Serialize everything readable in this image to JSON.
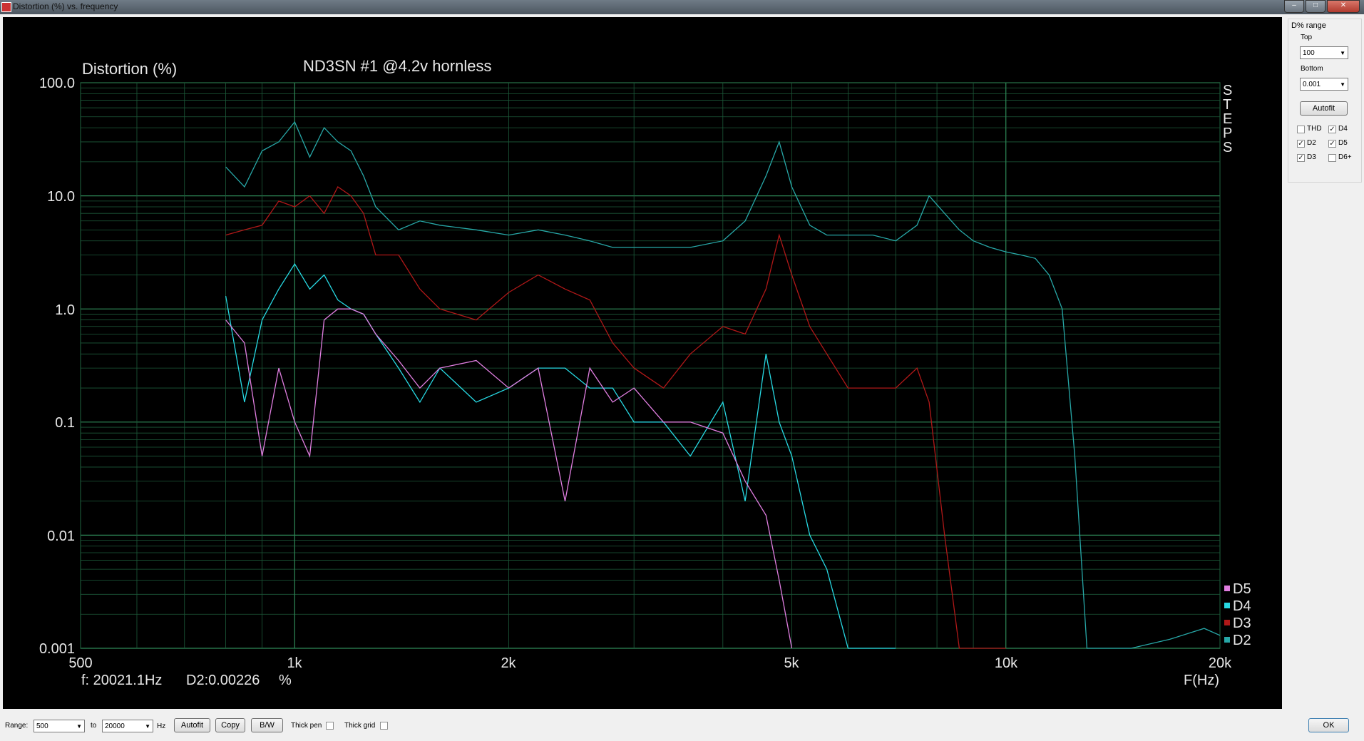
{
  "window": {
    "title": "Distortion (%) vs. frequency"
  },
  "plot": {
    "ylabel": "Distortion (%)",
    "title": "ND3SN #1 @4.2v hornless",
    "side_text": [
      "S",
      "T",
      "E",
      "P",
      "S"
    ],
    "xlabel": "F(Hz)",
    "yticks": [
      "100.0",
      "10.0",
      "1.0",
      "0.1",
      "0.01",
      "0.001"
    ],
    "xticks": [
      "500",
      "1k",
      "2k",
      "5k",
      "10k",
      "20k"
    ],
    "readout_f": "f: 20021.1Hz",
    "readout_d": "D2:0.00226",
    "readout_unit": "%",
    "legend": [
      {
        "name": "D5",
        "color": "#e07ee0"
      },
      {
        "name": "D4",
        "color": "#27d9e3"
      },
      {
        "name": "D3",
        "color": "#b01818"
      },
      {
        "name": "D2",
        "color": "#27a7a7"
      }
    ]
  },
  "side_panel": {
    "group_label": "D% range",
    "top_label": "Top",
    "top_value": "100",
    "bottom_label": "Bottom",
    "bottom_value": "0.001",
    "autofit": "Autofit",
    "checks": [
      {
        "label": "THD",
        "checked": false
      },
      {
        "label": "D4",
        "checked": true
      },
      {
        "label": "D2",
        "checked": true
      },
      {
        "label": "D5",
        "checked": true
      },
      {
        "label": "D3",
        "checked": true
      },
      {
        "label": "D6+",
        "checked": false
      }
    ]
  },
  "bottom_bar": {
    "range_label": "Range:",
    "range_from": "500",
    "to_label": "to",
    "range_to": "20000",
    "hz_label": "Hz",
    "autofit": "Autofit",
    "copy": "Copy",
    "bw": "B/W",
    "thick_pen": "Thick pen",
    "thick_grid": "Thick grid",
    "ok": "OK"
  },
  "chart_data": {
    "type": "line",
    "title": "ND3SN #1 @4.2v hornless",
    "xlabel": "F(Hz)",
    "ylabel": "Distortion (%)",
    "x_scale": "log",
    "y_scale": "log",
    "xlim": [
      500,
      20000
    ],
    "ylim": [
      0.001,
      100
    ],
    "grid": true,
    "legend_position": "bottom-right",
    "series": [
      {
        "name": "D2",
        "color": "#27a7a7",
        "x": [
          800,
          850,
          900,
          950,
          1000,
          1050,
          1100,
          1150,
          1200,
          1250,
          1300,
          1400,
          1500,
          1600,
          1800,
          2000,
          2200,
          2400,
          2600,
          2800,
          3000,
          3300,
          3600,
          4000,
          4300,
          4600,
          4800,
          5000,
          5300,
          5600,
          6000,
          6500,
          7000,
          7500,
          7800,
          8200,
          8600,
          9000,
          9500,
          10000,
          10500,
          11000,
          11500,
          12000,
          12500,
          13000,
          15000,
          17000,
          19000,
          20000
        ],
        "y": [
          18,
          12,
          25,
          30,
          45,
          22,
          40,
          30,
          25,
          15,
          8,
          5,
          6,
          5.5,
          5,
          4.5,
          5,
          4.5,
          4,
          3.5,
          3.5,
          3.5,
          3.5,
          4,
          6,
          15,
          30,
          12,
          5.5,
          4.5,
          4.5,
          4.5,
          4,
          5.5,
          10,
          7,
          5,
          4,
          3.5,
          3.2,
          3.0,
          2.8,
          2,
          1,
          0.05,
          0.001,
          0.001,
          0.0012,
          0.0015,
          0.0013
        ]
      },
      {
        "name": "D3",
        "color": "#b01818",
        "x": [
          800,
          850,
          900,
          950,
          1000,
          1050,
          1100,
          1150,
          1200,
          1250,
          1300,
          1400,
          1500,
          1600,
          1800,
          2000,
          2200,
          2400,
          2600,
          2800,
          3000,
          3300,
          3600,
          4000,
          4300,
          4600,
          4800,
          5000,
          5300,
          5600,
          6000,
          6500,
          7000,
          7500,
          7800,
          8200,
          8600,
          9000,
          9500,
          10000
        ],
        "y": [
          4.5,
          5,
          5.5,
          9,
          8,
          10,
          7,
          12,
          10,
          7,
          3,
          3,
          1.5,
          1,
          0.8,
          1.4,
          2,
          1.5,
          1.2,
          0.5,
          0.3,
          0.2,
          0.4,
          0.7,
          0.6,
          1.5,
          4.5,
          2,
          0.7,
          0.4,
          0.2,
          0.2,
          0.2,
          0.3,
          0.15,
          0.01,
          0.001,
          0.001,
          0.001,
          0.001
        ]
      },
      {
        "name": "D4",
        "color": "#27d9e3",
        "x": [
          800,
          850,
          900,
          950,
          1000,
          1050,
          1100,
          1150,
          1200,
          1250,
          1300,
          1400,
          1500,
          1600,
          1800,
          2000,
          2200,
          2400,
          2600,
          2800,
          3000,
          3300,
          3600,
          4000,
          4300,
          4600,
          4800,
          5000,
          5300,
          5600,
          6000,
          6500,
          7000
        ],
        "y": [
          1.3,
          0.15,
          0.8,
          1.5,
          2.5,
          1.5,
          2,
          1.2,
          1,
          0.9,
          0.6,
          0.3,
          0.15,
          0.3,
          0.15,
          0.2,
          0.3,
          0.3,
          0.2,
          0.2,
          0.1,
          0.1,
          0.05,
          0.15,
          0.02,
          0.4,
          0.1,
          0.05,
          0.01,
          0.005,
          0.001,
          0.001,
          0.001
        ]
      },
      {
        "name": "D5",
        "color": "#e07ee0",
        "x": [
          800,
          850,
          900,
          950,
          1000,
          1050,
          1100,
          1150,
          1200,
          1250,
          1300,
          1400,
          1500,
          1600,
          1800,
          2000,
          2200,
          2400,
          2600,
          2800,
          3000,
          3300,
          3600,
          4000,
          4300,
          4600,
          4800,
          5000
        ],
        "y": [
          0.8,
          0.5,
          0.05,
          0.3,
          0.1,
          0.05,
          0.8,
          1,
          1,
          0.9,
          0.6,
          0.35,
          0.2,
          0.3,
          0.35,
          0.2,
          0.3,
          0.02,
          0.3,
          0.15,
          0.2,
          0.1,
          0.1,
          0.08,
          0.03,
          0.015,
          0.004,
          0.001
        ]
      }
    ]
  }
}
